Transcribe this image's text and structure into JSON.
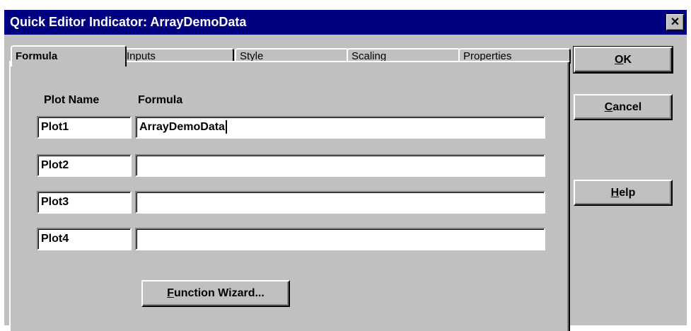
{
  "window": {
    "title": "Quick Editor Indicator: ArrayDemoData",
    "close_glyph": "✕"
  },
  "tabs": [
    {
      "label": "Formula",
      "active": true
    },
    {
      "label": "Inputs",
      "active": false
    },
    {
      "label": "Style",
      "active": false
    },
    {
      "label": "Scaling",
      "active": false
    },
    {
      "label": "Properties",
      "active": false
    }
  ],
  "formula_tab": {
    "plot_name_header": "Plot Name",
    "formula_header": "Formula",
    "rows": [
      {
        "plot_name": "Plot1",
        "formula": "ArrayDemoData"
      },
      {
        "plot_name": "Plot2",
        "formula": ""
      },
      {
        "plot_name": "Plot3",
        "formula": ""
      },
      {
        "plot_name": "Plot4",
        "formula": ""
      }
    ],
    "function_wizard_mnemonic": "F",
    "function_wizard_rest": "unction Wizard..."
  },
  "buttons": {
    "ok_mnemonic": "O",
    "ok_rest": "K",
    "cancel_mnemonic": "C",
    "cancel_rest": "ancel",
    "help_mnemonic": "H",
    "help_rest": "elp"
  }
}
